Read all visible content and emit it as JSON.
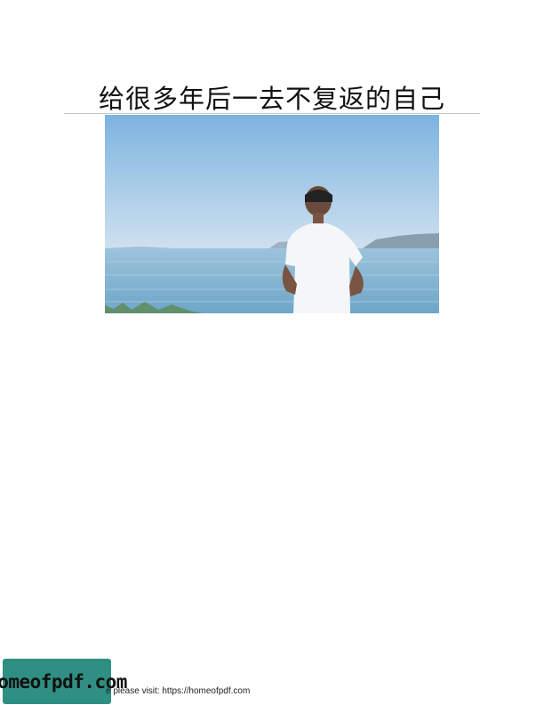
{
  "document": {
    "title": "给很多年后一去不复返的自己"
  },
  "photo": {
    "subject": "person-at-lakeshore",
    "colors": {
      "sky_top": "#7fb6e2",
      "sky_bottom": "#c9def0",
      "water": "#7fb3d2",
      "shirt": "#f4f6f8",
      "hills": "#8a9fae"
    }
  },
  "footer": {
    "badge_text": "homeofpdf.com",
    "visit_text": "e please visit: https://homeofpdf.com"
  }
}
